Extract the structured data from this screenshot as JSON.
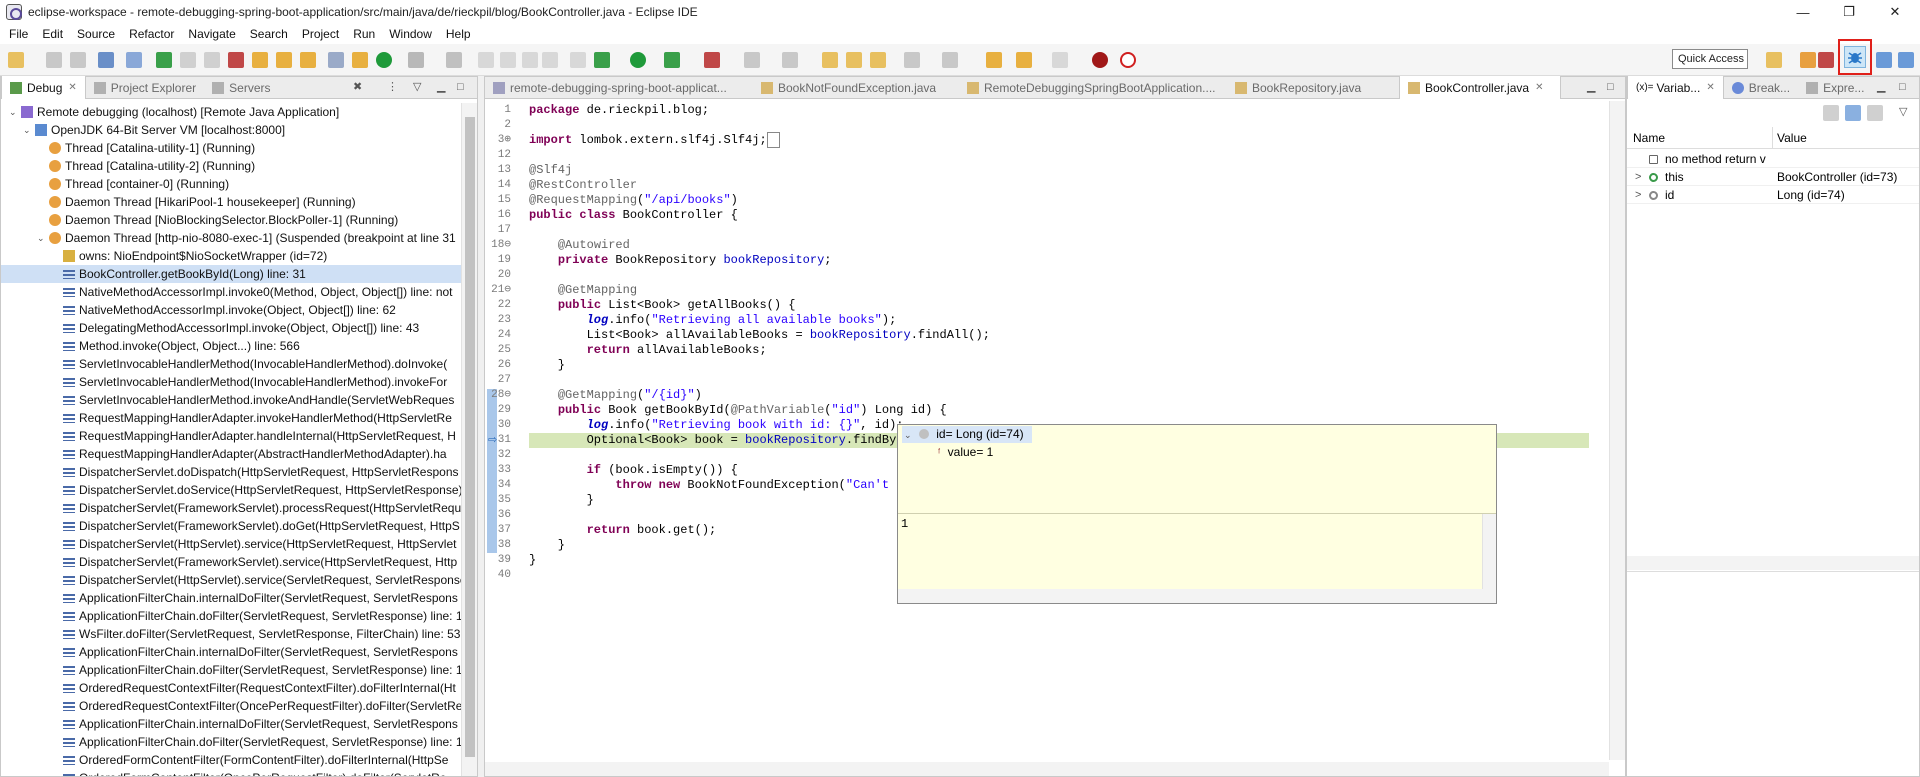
{
  "window": {
    "title": "eclipse-workspace - remote-debugging-spring-boot-application/src/main/java/de/rieckpil/blog/BookController.java - Eclipse IDE",
    "minimize": "—",
    "maximize": "❐",
    "close": "✕"
  },
  "menu": [
    "File",
    "Edit",
    "Source",
    "Refactor",
    "Navigate",
    "Search",
    "Project",
    "Run",
    "Window",
    "Help"
  ],
  "toolbar": {
    "quick_access": "Quick Access"
  },
  "debug_view": {
    "tabs": [
      {
        "label": "Debug",
        "active": true
      },
      {
        "label": "Project Explorer",
        "active": false
      },
      {
        "label": "Servers",
        "active": false
      }
    ],
    "tree": [
      {
        "text": "Remote debugging (localhost) [Remote Java Application]",
        "indent": 0,
        "expand": "v",
        "icon": "launch-icon",
        "selected": false
      },
      {
        "text": "OpenJDK 64-Bit Server VM [localhost:8000]",
        "indent": 1,
        "expand": "v",
        "icon": "vm-icon",
        "selected": false
      },
      {
        "text": "Thread [Catalina-utility-1] (Running)",
        "indent": 2,
        "expand": "",
        "icon": "thread-running-icon",
        "selected": false
      },
      {
        "text": "Thread [Catalina-utility-2] (Running)",
        "indent": 2,
        "expand": "",
        "icon": "thread-running-icon",
        "selected": false
      },
      {
        "text": "Thread [container-0] (Running)",
        "indent": 2,
        "expand": "",
        "icon": "thread-running-icon",
        "selected": false
      },
      {
        "text": "Daemon Thread [HikariPool-1 housekeeper] (Running)",
        "indent": 2,
        "expand": "",
        "icon": "thread-running-icon",
        "selected": false
      },
      {
        "text": "Daemon Thread [NioBlockingSelector.BlockPoller-1] (Running)",
        "indent": 2,
        "expand": "",
        "icon": "thread-running-icon",
        "selected": false
      },
      {
        "text": "Daemon Thread [http-nio-8080-exec-1] (Suspended (breakpoint at line 31",
        "indent": 2,
        "expand": "v",
        "icon": "thread-suspended-icon",
        "selected": false
      },
      {
        "text": "owns: NioEndpoint$NioSocketWrapper  (id=72)",
        "indent": 3,
        "expand": "",
        "icon": "monitor-icon",
        "selected": false
      },
      {
        "text": "BookController.getBookById(Long) line: 31",
        "indent": 3,
        "expand": "",
        "icon": "stack-frame-icon",
        "selected": true
      },
      {
        "text": "NativeMethodAccessorImpl.invoke0(Method, Object, Object[]) line: not",
        "indent": 3,
        "expand": "",
        "icon": "stack-frame-icon",
        "selected": false
      },
      {
        "text": "NativeMethodAccessorImpl.invoke(Object, Object[]) line: 62",
        "indent": 3,
        "expand": "",
        "icon": "stack-frame-icon",
        "selected": false
      },
      {
        "text": "DelegatingMethodAccessorImpl.invoke(Object, Object[]) line: 43",
        "indent": 3,
        "expand": "",
        "icon": "stack-frame-icon",
        "selected": false
      },
      {
        "text": "Method.invoke(Object, Object...) line: 566",
        "indent": 3,
        "expand": "",
        "icon": "stack-frame-icon",
        "selected": false
      },
      {
        "text": "ServletInvocableHandlerMethod(InvocableHandlerMethod).doInvoke(",
        "indent": 3,
        "expand": "",
        "icon": "stack-frame-icon",
        "selected": false
      },
      {
        "text": "ServletInvocableHandlerMethod(InvocableHandlerMethod).invokeFor",
        "indent": 3,
        "expand": "",
        "icon": "stack-frame-icon",
        "selected": false
      },
      {
        "text": "ServletInvocableHandlerMethod.invokeAndHandle(ServletWebReques",
        "indent": 3,
        "expand": "",
        "icon": "stack-frame-icon",
        "selected": false
      },
      {
        "text": "RequestMappingHandlerAdapter.invokeHandlerMethod(HttpServletRe",
        "indent": 3,
        "expand": "",
        "icon": "stack-frame-icon",
        "selected": false
      },
      {
        "text": "RequestMappingHandlerAdapter.handleInternal(HttpServletRequest, H",
        "indent": 3,
        "expand": "",
        "icon": "stack-frame-icon",
        "selected": false
      },
      {
        "text": "RequestMappingHandlerAdapter(AbstractHandlerMethodAdapter).ha",
        "indent": 3,
        "expand": "",
        "icon": "stack-frame-icon",
        "selected": false
      },
      {
        "text": "DispatcherServlet.doDispatch(HttpServletRequest, HttpServletRespons",
        "indent": 3,
        "expand": "",
        "icon": "stack-frame-icon",
        "selected": false
      },
      {
        "text": "DispatcherServlet.doService(HttpServletRequest, HttpServletResponse)",
        "indent": 3,
        "expand": "",
        "icon": "stack-frame-icon",
        "selected": false
      },
      {
        "text": "DispatcherServlet(FrameworkServlet).processRequest(HttpServletRequ",
        "indent": 3,
        "expand": "",
        "icon": "stack-frame-icon",
        "selected": false
      },
      {
        "text": "DispatcherServlet(FrameworkServlet).doGet(HttpServletRequest, HttpS",
        "indent": 3,
        "expand": "",
        "icon": "stack-frame-icon",
        "selected": false
      },
      {
        "text": "DispatcherServlet(HttpServlet).service(HttpServletRequest, HttpServlet",
        "indent": 3,
        "expand": "",
        "icon": "stack-frame-icon",
        "selected": false
      },
      {
        "text": "DispatcherServlet(FrameworkServlet).service(HttpServletRequest, Http",
        "indent": 3,
        "expand": "",
        "icon": "stack-frame-icon",
        "selected": false
      },
      {
        "text": "DispatcherServlet(HttpServlet).service(ServletRequest, ServletResponse",
        "indent": 3,
        "expand": "",
        "icon": "stack-frame-icon",
        "selected": false
      },
      {
        "text": "ApplicationFilterChain.internalDoFilter(ServletRequest, ServletRespons",
        "indent": 3,
        "expand": "",
        "icon": "stack-frame-icon",
        "selected": false
      },
      {
        "text": "ApplicationFilterChain.doFilter(ServletRequest, ServletResponse) line: 1",
        "indent": 3,
        "expand": "",
        "icon": "stack-frame-icon",
        "selected": false
      },
      {
        "text": "WsFilter.doFilter(ServletRequest, ServletResponse, FilterChain) line: 53",
        "indent": 3,
        "expand": "",
        "icon": "stack-frame-icon",
        "selected": false
      },
      {
        "text": "ApplicationFilterChain.internalDoFilter(ServletRequest, ServletRespons",
        "indent": 3,
        "expand": "",
        "icon": "stack-frame-icon",
        "selected": false
      },
      {
        "text": "ApplicationFilterChain.doFilter(ServletRequest, ServletResponse) line: 1",
        "indent": 3,
        "expand": "",
        "icon": "stack-frame-icon",
        "selected": false
      },
      {
        "text": "OrderedRequestContextFilter(RequestContextFilter).doFilterInternal(Ht",
        "indent": 3,
        "expand": "",
        "icon": "stack-frame-icon",
        "selected": false
      },
      {
        "text": "OrderedRequestContextFilter(OncePerRequestFilter).doFilter(ServletRe",
        "indent": 3,
        "expand": "",
        "icon": "stack-frame-icon",
        "selected": false
      },
      {
        "text": "ApplicationFilterChain.internalDoFilter(ServletRequest, ServletRespons",
        "indent": 3,
        "expand": "",
        "icon": "stack-frame-icon",
        "selected": false
      },
      {
        "text": "ApplicationFilterChain.doFilter(ServletRequest, ServletResponse) line: 1",
        "indent": 3,
        "expand": "",
        "icon": "stack-frame-icon",
        "selected": false
      },
      {
        "text": "OrderedFormContentFilter(FormContentFilter).doFilterInternal(HttpSe",
        "indent": 3,
        "expand": "",
        "icon": "stack-frame-icon",
        "selected": false
      },
      {
        "text": "OrderedFormContentFilter(OncePerRequestFilter).doFilter(ServletRe",
        "indent": 3,
        "expand": "",
        "icon": "stack-frame-icon",
        "selected": false
      }
    ]
  },
  "editor": {
    "tabs": [
      {
        "label": "remote-debugging-spring-boot-applicat...",
        "active": false
      },
      {
        "label": "BookNotFoundException.java",
        "active": false
      },
      {
        "label": "RemoteDebuggingSpringBootApplication....",
        "active": false
      },
      {
        "label": "BookRepository.java",
        "active": false
      },
      {
        "label": "BookController.java",
        "active": true
      }
    ],
    "lines": [
      {
        "n": "1",
        "html": "<span class=\"kw\">package</span> de.rieckpil.blog;"
      },
      {
        "n": "2",
        "html": ""
      },
      {
        "n": "3⊕",
        "html": "<span class=\"kw\">import</span> lombok.extern.slf4j.Slf4j;<span style=\"border:1px solid #888;padding:0 2px;\"> </span>"
      },
      {
        "n": "12",
        "html": ""
      },
      {
        "n": "13",
        "html": "<span class=\"ann\">@Slf4j</span>"
      },
      {
        "n": "14",
        "html": "<span class=\"ann\">@RestController</span>"
      },
      {
        "n": "15",
        "html": "<span class=\"ann\">@RequestMapping</span>(<span class=\"str\">\"/api/books\"</span>)"
      },
      {
        "n": "16",
        "html": "<span class=\"kw\">public class</span> BookController {"
      },
      {
        "n": "17",
        "html": ""
      },
      {
        "n": "18⊖",
        "html": "    <span class=\"ann\">@Autowired</span>"
      },
      {
        "n": "19",
        "html": "    <span class=\"kw\">private</span> BookRepository <span class=\"fld\">bookRepository</span>;"
      },
      {
        "n": "20",
        "html": ""
      },
      {
        "n": "21⊖",
        "html": "    <span class=\"ann\">@GetMapping</span>"
      },
      {
        "n": "22",
        "html": "    <span class=\"kw\">public</span> List&lt;Book&gt; getAllBooks() {"
      },
      {
        "n": "23",
        "html": "        <span class=\"stat\">log</span>.info(<span class=\"str\">\"Retrieving all available books\"</span>);"
      },
      {
        "n": "24",
        "html": "        List&lt;Book&gt; allAvailableBooks = <span class=\"fld\">bookRepository</span>.findAll();"
      },
      {
        "n": "25",
        "html": "        <span class=\"kw\">return</span> allAvailableBooks;"
      },
      {
        "n": "26",
        "html": "    }"
      },
      {
        "n": "27",
        "html": ""
      },
      {
        "n": "28⊖",
        "html": "    <span class=\"ann\">@GetMapping</span>(<span class=\"str\">\"/{id}\"</span>)"
      },
      {
        "n": "29",
        "html": "    <span class=\"kw\">public</span> Book getBookById(<span class=\"ann\">@PathVariable</span>(<span class=\"str\">\"id\"</span>) Long id) {"
      },
      {
        "n": "30",
        "html": "        <span class=\"stat\">log</span>.info(<span class=\"str\">\"Retrieving book with id: {}\"</span>, id);"
      },
      {
        "n": "31",
        "html": "        Optional&lt;Book&gt; book = <span class=\"fld\">bookRepository</span>.findById(id);",
        "current": true
      },
      {
        "n": "32",
        "html": ""
      },
      {
        "n": "33",
        "html": "        <span class=\"kw\">if</span> (book.isEmpty()) {"
      },
      {
        "n": "34",
        "html": "            <span class=\"kw\">throw new</span> BookNotFoundException(<span class=\"str\">\"Can't find book\"</span>);"
      },
      {
        "n": "35",
        "html": "        }"
      },
      {
        "n": "36",
        "html": ""
      },
      {
        "n": "37",
        "html": "        <span class=\"kw\">return</span> book.get();"
      },
      {
        "n": "38",
        "html": "    }"
      },
      {
        "n": "39",
        "html": "}"
      },
      {
        "n": "40",
        "html": ""
      }
    ],
    "hover": {
      "variable": "id= Long  (id=74)",
      "field": "value= 1",
      "detail": "1"
    }
  },
  "variables_view": {
    "tabs": [
      {
        "label": "Variab...",
        "active": true
      },
      {
        "label": "Break...",
        "active": false
      },
      {
        "label": "Expre...",
        "active": false
      }
    ],
    "columns": {
      "name": "Name",
      "value": "Value"
    },
    "rows": [
      {
        "name": "no method return v",
        "value": "",
        "expand": "",
        "icon": "return-icon"
      },
      {
        "name": "this",
        "value": "BookController  (id=73)",
        "expand": ">",
        "icon": "field-icon"
      },
      {
        "name": "id",
        "value": "Long  (id=74)",
        "expand": ">",
        "icon": "local-variable-icon"
      }
    ]
  },
  "colors": {
    "current_line": "#d7e7b8",
    "selection": "#cfe0f5",
    "hover_bg": "#ffffe1",
    "highlight_border": "#e0201a"
  }
}
